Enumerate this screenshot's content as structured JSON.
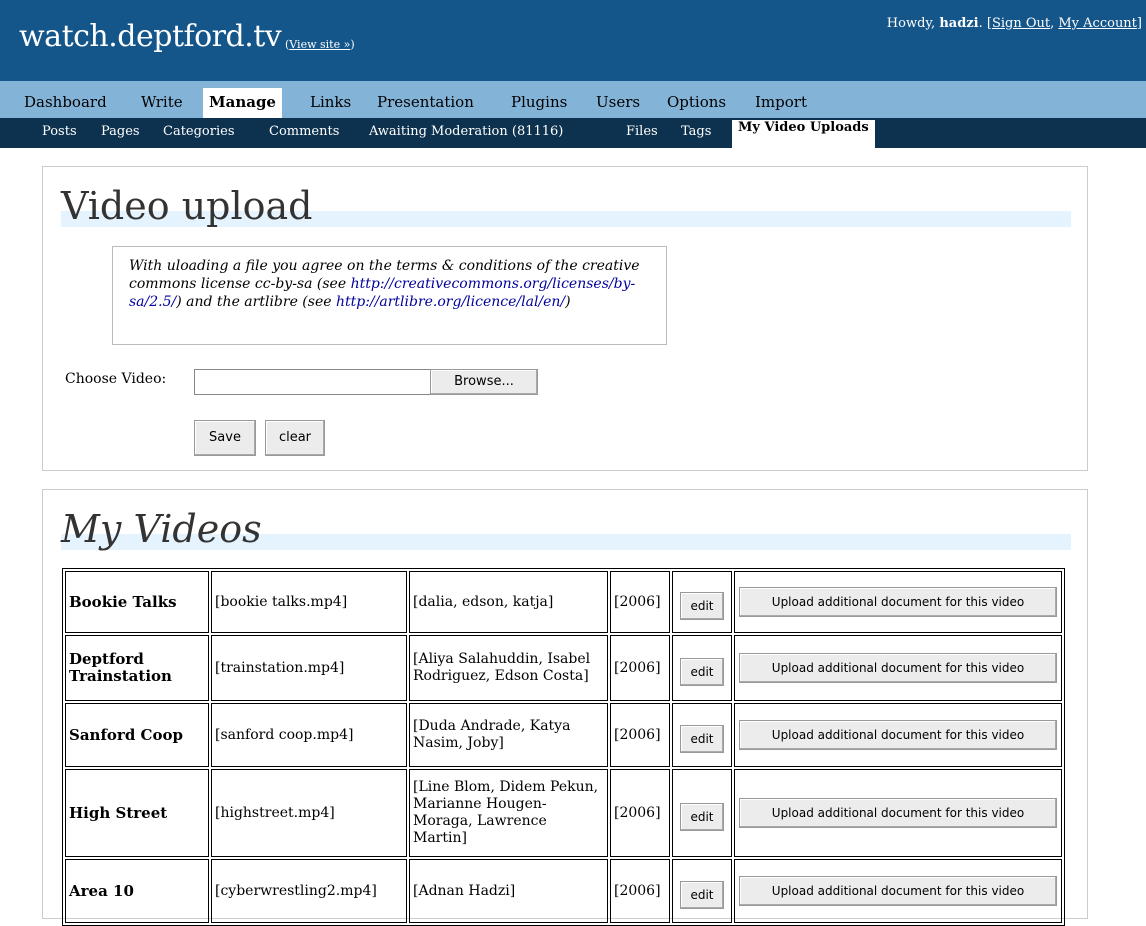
{
  "header": {
    "site_title": "watch.deptford.tv",
    "view_site": "View site »",
    "howdy": "Howdy,",
    "username": "hadzi",
    "sign_out": "Sign Out",
    "my_account": "My Account"
  },
  "menu": {
    "items": [
      "Dashboard",
      "Write",
      "Manage",
      "Links",
      "Presentation",
      "Plugins",
      "Users",
      "Options",
      "Import"
    ],
    "current": "Manage"
  },
  "submenu": {
    "items": [
      "Posts",
      "Pages",
      "Categories",
      "Comments",
      "Awaiting Moderation (81116)",
      "Files",
      "Tags",
      "My Video Uploads"
    ],
    "current": "My Video Uploads"
  },
  "upload": {
    "heading": "Video upload",
    "terms_1": "With uloading a file you agree on the terms & conditions of the creative commons license cc-by-sa (see",
    "terms_link1": "http://creativecommons.org/licenses/by-sa/2.5/",
    "terms_2": ") and the artlibre (see",
    "terms_link2": "http://artlibre.org/licence/lal/en/",
    "terms_3": ")",
    "choose_label": "Choose Video:",
    "file_value": "",
    "browse_label": "Browse...",
    "save_label": "Save",
    "clear_label": "clear"
  },
  "videos": {
    "heading": "My Videos",
    "edit_label": "edit",
    "upload_doc_label": "Upload additional document for this video",
    "rows": [
      {
        "title": "Bookie Talks",
        "file": "[bookie talks.mp4]",
        "people": "[dalia, edson, katja]",
        "year": "[2006]"
      },
      {
        "title": "Deptford Trainstation",
        "file": "[trainstation.mp4]",
        "people": "[Aliya Salahuddin, Isabel Rodriguez, Edson Costa]",
        "year": "[2006]"
      },
      {
        "title": "Sanford Coop",
        "file": "[sanford coop.mp4]",
        "people": "[Duda Andrade, Katya Nasim, Joby]",
        "year": "[2006]"
      },
      {
        "title": "High Street",
        "file": "[highstreet.mp4]",
        "people": "[Line Blom, Didem Pekun, Marianne Hougen-Moraga, Lawrence Martin]",
        "year": "[2006]"
      },
      {
        "title": "Area 10",
        "file": "[cyberwrestling2.mp4]",
        "people": "[Adnan Hadzi]",
        "year": "[2006]"
      }
    ]
  },
  "colors": {
    "header_bg": "#14568a",
    "menu_bg": "#83b4d8",
    "submenu_bg": "#0d324f",
    "heading_bar": "#e5f3ff",
    "link": "#00019b"
  }
}
